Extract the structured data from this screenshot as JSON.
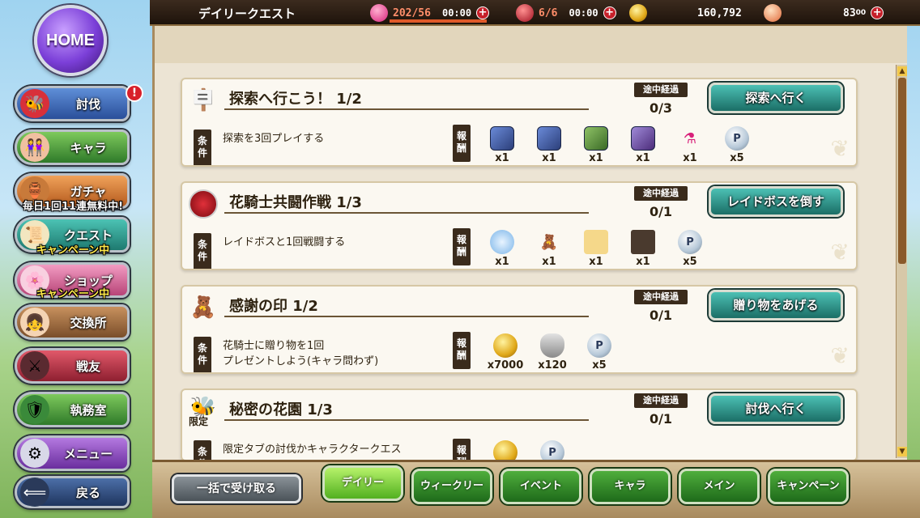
{
  "sidebar": {
    "home_label": "HOME",
    "items": [
      {
        "label": "討伐",
        "icon": "bee-icon"
      },
      {
        "label": "キャラ",
        "icon": "characters-icon"
      },
      {
        "label": "ガチャ",
        "icon": "pot-icon",
        "banner": "毎日1回11連無料中!"
      },
      {
        "label": "クエスト",
        "icon": "scroll-icon",
        "banner": "キャンペーン中"
      },
      {
        "label": "ショップ",
        "icon": "flower-icon",
        "banner": "キャンペーン中"
      },
      {
        "label": "交換所",
        "icon": "girl-icon"
      },
      {
        "label": "戦友",
        "icon": "swords-icon"
      },
      {
        "label": "執務室",
        "icon": "emblem-icon"
      },
      {
        "label": "メニュー",
        "icon": "gear-icon"
      },
      {
        "label": "戻る",
        "icon": "back-arrow-icon"
      }
    ],
    "alert": "!"
  },
  "topbar": {
    "title": "デイリークエスト",
    "stamina": "202/56",
    "stamina_timer": "00:00",
    "raid": "6/6",
    "raid_timer": "00:00",
    "gold": "160,792",
    "flower_stones": "83",
    "flower_stones_suffix": "00"
  },
  "quests": [
    {
      "title": "探索へ行こう！ 1/2",
      "progress_label": "途中経過",
      "progress": "0/3",
      "button": "探索へ行く",
      "cond_tag": "条件",
      "condition": "探索を3回プレイする",
      "reward_tag": "報酬",
      "rewards": [
        {
          "kind": "char",
          "qty": "x1"
        },
        {
          "kind": "char",
          "qty": "x1"
        },
        {
          "kind": "charg",
          "qty": "x1"
        },
        {
          "kind": "charp",
          "qty": "x1"
        },
        {
          "kind": "potion",
          "qty": "x1"
        },
        {
          "kind": "pcoin",
          "qty": "x5"
        }
      ]
    },
    {
      "title": "花騎士共闘作戦 1/3",
      "progress_label": "途中経過",
      "progress": "0/1",
      "button": "レイドボスを倒す",
      "cond_tag": "条件",
      "condition": "レイドボスと1回戦闘する",
      "reward_tag": "報酬",
      "rewards": [
        {
          "kind": "ring",
          "qty": "x1"
        },
        {
          "kind": "bear",
          "qty": "x1"
        },
        {
          "kind": "gem",
          "qty": "x1"
        },
        {
          "kind": "book",
          "qty": "x1"
        },
        {
          "kind": "pcoin",
          "qty": "x5"
        }
      ]
    },
    {
      "title": "感謝の印 1/2",
      "progress_label": "途中経過",
      "progress": "0/1",
      "button": "贈り物をあげる",
      "cond_tag": "条件",
      "condition": "花騎士に贈り物を1回\nプレゼントしよう(キャラ問わず)",
      "reward_tag": "報酬",
      "rewards": [
        {
          "kind": "coin",
          "qty": "x7000"
        },
        {
          "kind": "bucket",
          "qty": "x120"
        },
        {
          "kind": "pcoin",
          "qty": "x5"
        }
      ]
    },
    {
      "title": "秘密の花園 1/3",
      "limited": "限定",
      "progress_label": "途中経過",
      "progress": "0/1",
      "button": "討伐へ行く",
      "cond_tag": "条件",
      "condition": "限定タブの討伐かキャラクタークエス",
      "reward_tag": "報酬",
      "rewards": [
        {
          "kind": "coin",
          "qty": ""
        },
        {
          "kind": "pcoin",
          "qty": ""
        }
      ]
    }
  ],
  "bottom": {
    "receive_all": "一括で受け取る",
    "tabs": [
      "デイリー",
      "ウィークリー",
      "イベント",
      "キャラ",
      "メイン",
      "キャンペーン"
    ],
    "active_tab": 0
  },
  "colors": {
    "accent_teal": "#1b6e66",
    "tab_green": "#1e6a1a",
    "active_tab": "#b6f26a"
  }
}
